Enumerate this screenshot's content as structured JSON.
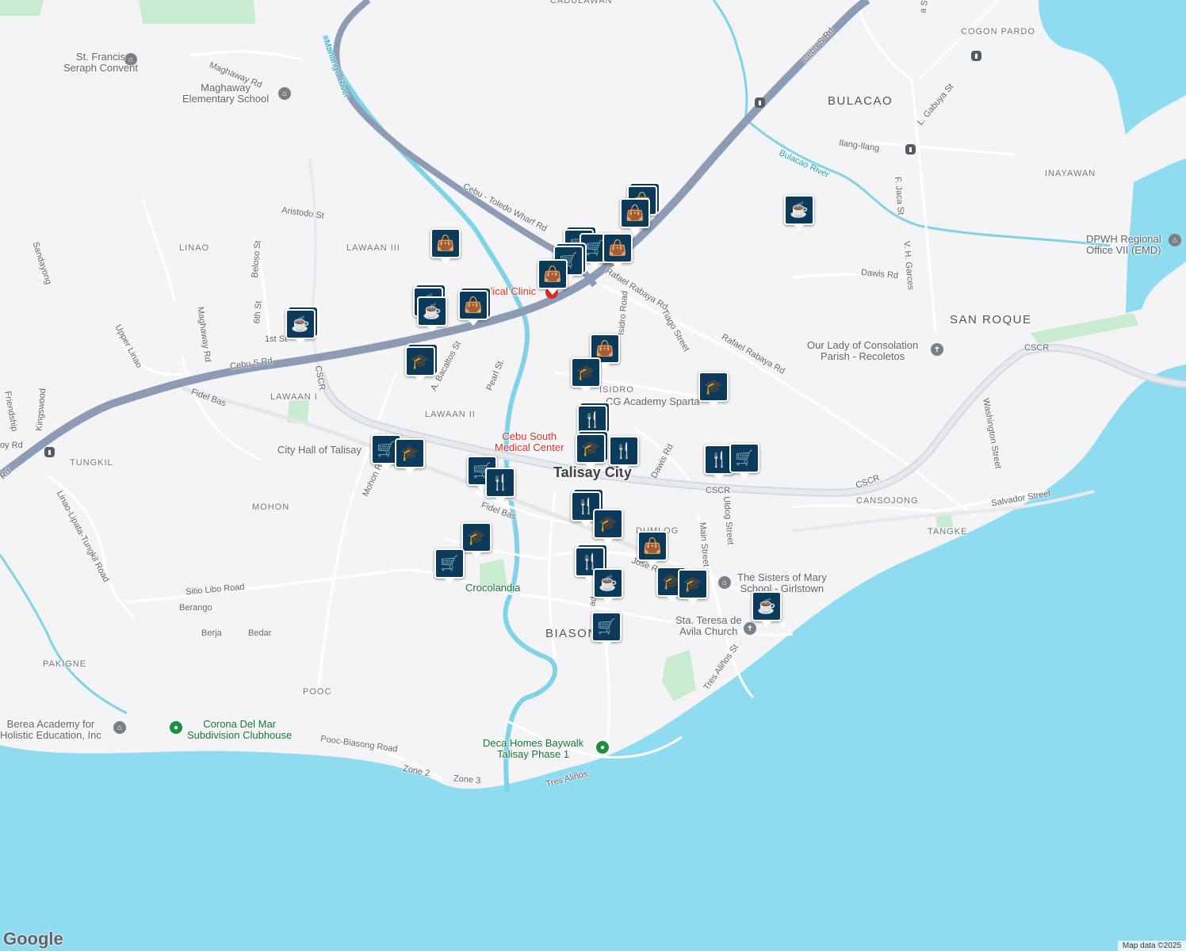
{
  "map": {
    "center_label": "Talisay City",
    "colors": {
      "land": "#f4f4f6",
      "water": "#8fdbef",
      "highway": "#8d9bb4",
      "road": "#ffffff",
      "park": "#c9ebd0",
      "marker": "#0b3a5b",
      "river": "#7fd3e6"
    }
  },
  "area_labels": [
    "CADULAWAN",
    "COGON PARDO",
    "BULACAO",
    "INAYAWAN",
    "LINAO",
    "LAWAAN III",
    "LAWAAN I",
    "LAWAAN II",
    "TUNGKIL",
    "MOHON",
    "SAN ROQUE",
    "CANSOJONG",
    "TANGKE",
    "DUMLOG",
    "BIASON",
    "PAKIGNE",
    "POOC",
    "ISIDRO"
  ],
  "road_labels": [
    "Cebu S Rd",
    "Cebu - Toledo Wharf Rd",
    "Cebu S Rd",
    "Maghaway Rd",
    "Maghaway Rd",
    "Aristodo St",
    "Beloso St",
    "6th St",
    "1st St",
    "Sandayong",
    "Upper Linao",
    "Kingswood",
    "Friendship",
    "oy Rd",
    "Rd",
    "Fidel Bas",
    "Fidel Bas",
    "CSCR",
    "CSCR",
    "CSCR",
    "CSCR",
    "Mohon Rd",
    "A. Bacaltos St",
    "Pearl St.",
    "Rafael Rabaya Rd",
    "Rafael Rabaya Rd",
    "Tiago Street",
    "Isidro Road",
    "Dawis Rd",
    "Dawis Rd",
    "Uldog Street",
    "Main Street",
    "Jose R",
    "ad",
    "Washington Street",
    "Salvador Street",
    "Ilang-Ilang",
    "L. Gabuya St",
    "F. Jaca St",
    "V. H. Garces",
    "Sitio Libo Road",
    "Berango",
    "Berja",
    "Bedar",
    "Linao-Lipata-Tungkil Road",
    "Pooc-Biasong Road",
    "Zone 2",
    "Zone 3",
    "Tres Aliños",
    "Tres Aliños St",
    "a St"
  ],
  "river_labels": [
    "Manang'a River",
    "Bulacao River"
  ],
  "poi_labels": [
    {
      "text": "St. Francis\nSeraph Convent",
      "kind": "grey"
    },
    {
      "text": "Maghaway\nElementary School",
      "kind": "grey"
    },
    {
      "text": "Medical Clinic",
      "kind": "red"
    },
    {
      "text": "Cebu South\nMedical Center",
      "kind": "red"
    },
    {
      "text": "City Hall of Talisay",
      "kind": "grey"
    },
    {
      "text": "CG Academy Sparta",
      "kind": "grey"
    },
    {
      "text": "DPWH Regional\nOffice VII (EMD)",
      "kind": "grey"
    },
    {
      "text": "Our Lady of Consolation\nParish - Recoletos",
      "kind": "grey"
    },
    {
      "text": "The Sisters of Mary\nSchool - Girlstown",
      "kind": "grey"
    },
    {
      "text": "Sta. Teresa de\nAvila Church",
      "kind": "grey"
    },
    {
      "text": "Crocolandia",
      "kind": "green"
    },
    {
      "text": "Berea Academy for\nHolistic Education, Inc",
      "kind": "grey"
    },
    {
      "text": "Corona Del Mar\nSubdivision Clubhouse",
      "kind": "green"
    },
    {
      "text": "Deca Homes Baywalk\nTalisay Phase 1",
      "kind": "green"
    }
  ],
  "markers": [
    {
      "icon": "shopping-bag"
    },
    {
      "icon": "shopping-bag"
    },
    {
      "icon": "shopping-bag"
    },
    {
      "icon": "coffee"
    },
    {
      "icon": "shopping-cart"
    },
    {
      "icon": "shopping-cart"
    },
    {
      "icon": "shopping-cart"
    },
    {
      "icon": "shopping-bag"
    },
    {
      "icon": "shopping-bag"
    },
    {
      "icon": "coffee"
    },
    {
      "icon": "coffee"
    },
    {
      "icon": "shopping-bag"
    },
    {
      "icon": "coffee"
    },
    {
      "icon": "school"
    },
    {
      "icon": "shopping-bag"
    },
    {
      "icon": "school"
    },
    {
      "icon": "school"
    },
    {
      "icon": "restaurant"
    },
    {
      "icon": "school"
    },
    {
      "icon": "restaurant"
    },
    {
      "icon": "shopping-cart"
    },
    {
      "icon": "school"
    },
    {
      "icon": "shopping-cart"
    },
    {
      "icon": "restaurant"
    },
    {
      "icon": "restaurant"
    },
    {
      "icon": "shopping-cart"
    },
    {
      "icon": "restaurant"
    },
    {
      "icon": "school"
    },
    {
      "icon": "school"
    },
    {
      "icon": "shopping-cart"
    },
    {
      "icon": "shopping-bag"
    },
    {
      "icon": "restaurant"
    },
    {
      "icon": "coffee"
    },
    {
      "icon": "school"
    },
    {
      "icon": "school"
    },
    {
      "icon": "coffee"
    },
    {
      "icon": "shopping-cart"
    }
  ],
  "icon_glyphs": {
    "shopping-bag": "👜",
    "shopping-cart": "🛒",
    "coffee": "☕",
    "school": "🎓",
    "restaurant": "🍴"
  },
  "logo_text": "Google",
  "attribution": "Map data ©2025"
}
